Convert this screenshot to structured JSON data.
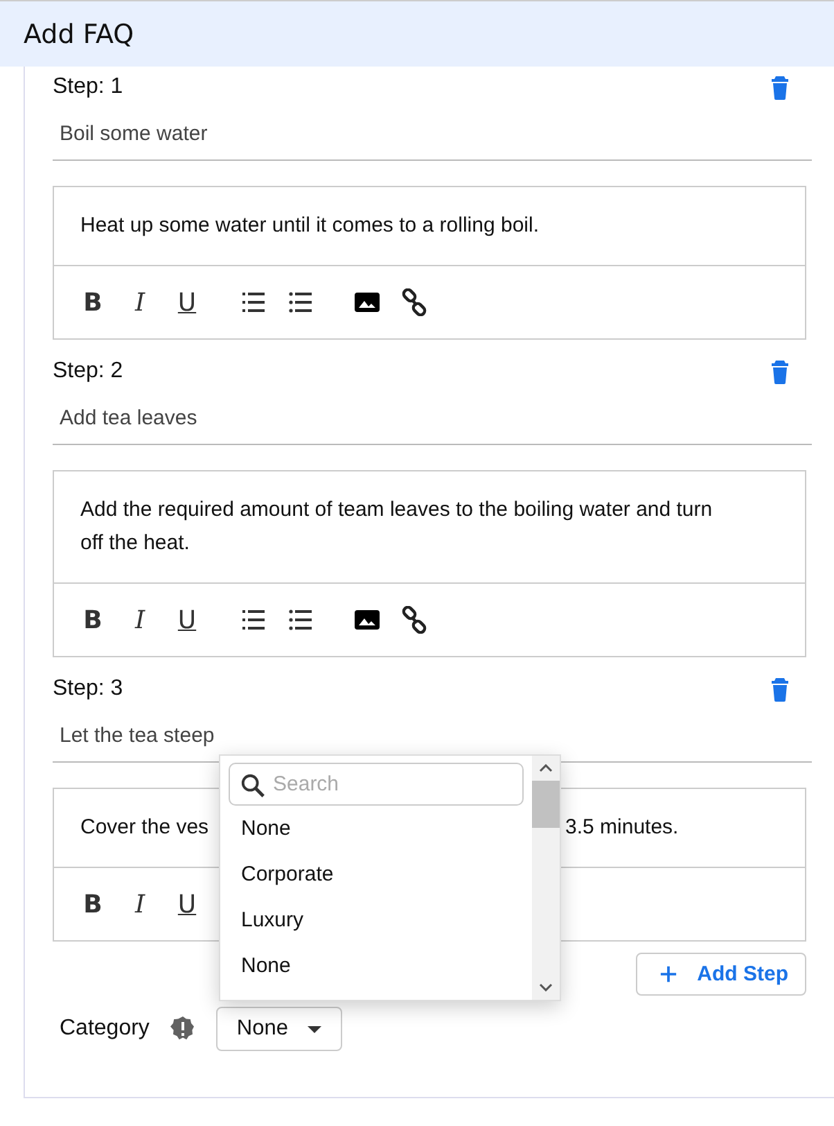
{
  "header": {
    "title": "Add FAQ"
  },
  "steps": [
    {
      "label": "Step: 1",
      "title": "Boil some water",
      "description": [
        "Heat up some water until it comes to a rolling boil."
      ],
      "tools": [
        {
          "kind": "bold",
          "label": "B"
        },
        {
          "kind": "italic",
          "label": "I"
        },
        {
          "kind": "underline",
          "label": "U"
        },
        {
          "kind": "ordered"
        },
        {
          "kind": "bulleted"
        },
        {
          "kind": "image"
        },
        {
          "kind": "link"
        }
      ]
    },
    {
      "label": "Step: 2",
      "title": "Add tea leaves",
      "description": [
        "Add the required amount of team leaves to the boiling water and turn off the heat."
      ],
      "tools": [
        {
          "kind": "bold",
          "label": "B"
        },
        {
          "kind": "italic",
          "label": "I"
        },
        {
          "kind": "underline",
          "label": "U"
        },
        {
          "kind": "ordered"
        },
        {
          "kind": "bulleted"
        },
        {
          "kind": "image"
        },
        {
          "kind": "link"
        }
      ]
    },
    {
      "label": "Step: 3",
      "title": "Let the tea steep",
      "description": [
        "Cover the ves",
        "3.5 minutes."
      ],
      "tools": [
        {
          "kind": "bold",
          "label": "B"
        },
        {
          "kind": "italic",
          "label": "I"
        },
        {
          "kind": "underline",
          "label": "U"
        }
      ]
    }
  ],
  "add_step": {
    "label": "Add Step"
  },
  "category": {
    "label": "Category",
    "value": "None"
  },
  "dropdown": {
    "search": {
      "placeholder": "Search"
    },
    "options": [
      "None",
      "Corporate",
      "Luxury",
      "None"
    ]
  }
}
